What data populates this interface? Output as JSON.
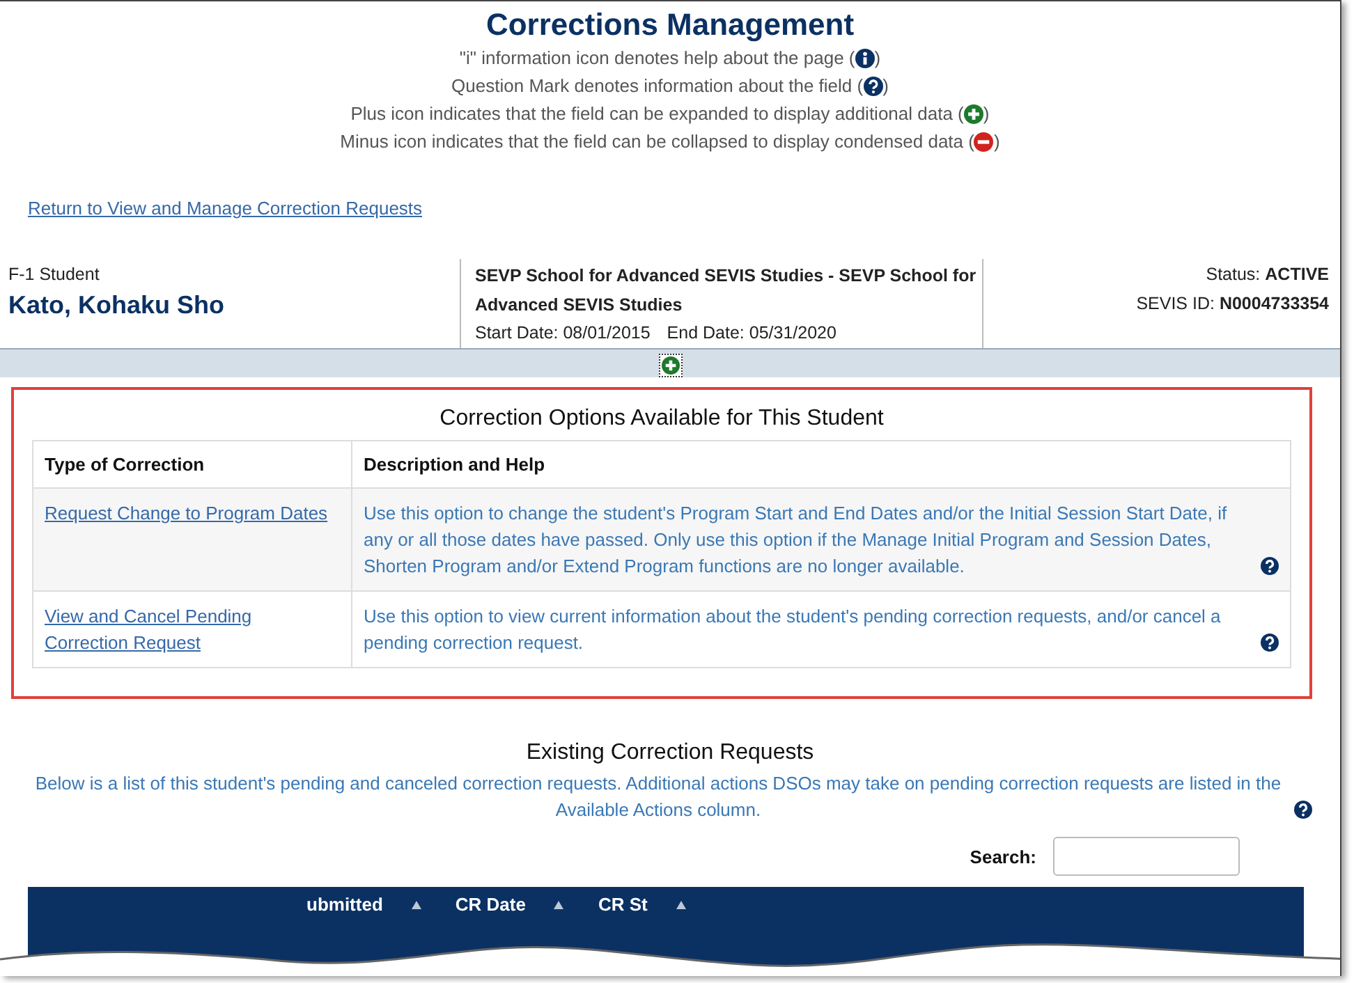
{
  "title": "Corrections Management",
  "legend": [
    {
      "text": "\"i\" information icon denotes help about the page (",
      "kind": "info",
      "close": ")"
    },
    {
      "text": "Question Mark denotes information about the field (",
      "kind": "question",
      "close": ")"
    },
    {
      "text": "Plus icon indicates that the field can be expanded to display additional data (",
      "kind": "plus",
      "close": ")"
    },
    {
      "text": "Minus icon indicates that the field can be collapsed to display condensed data (",
      "kind": "minus",
      "close": ")"
    }
  ],
  "return_link": "Return to View and Manage Correction Requests",
  "student": {
    "type": "F-1 Student",
    "name": "Kato, Kohaku Sho"
  },
  "school": {
    "name": "SEVP School for Advanced SEVIS Studies - SEVP School for Advanced SEVIS Studies",
    "start_label": "Start Date:",
    "start": "08/01/2015",
    "end_label": "End Date:",
    "end": "05/31/2020"
  },
  "status": {
    "label": "Status:",
    "value": "ACTIVE"
  },
  "sevis": {
    "label": "SEVIS ID:",
    "value": "N0004733354"
  },
  "details_expanded": false,
  "options": {
    "title": "Correction Options Available for This Student",
    "columns": [
      "Type of Correction",
      "Description and Help"
    ],
    "rows": [
      {
        "link": "Request Change to Program Dates",
        "description": "Use this option to change the student's Program Start and End Dates and/or the Initial Session Start Date, if any or all those dates have passed. Only use this option if the Manage Initial Program and Session Dates, Shorten Program and/or Extend Program functions are no longer available."
      },
      {
        "link": "View and Cancel Pending Correction Request",
        "description": "Use this option to view current information about the student's pending correction requests, and/or cancel a pending correction request."
      }
    ]
  },
  "existing": {
    "title": "Existing Correction Requests",
    "description": "Below is a list of this student's pending and canceled correction requests. Additional actions DSOs may take on pending correction requests are listed in the Available Actions column."
  },
  "search": {
    "label": "Search:"
  },
  "requests_table": {
    "columns": [
      "ubmitted",
      "CR Date",
      "CR St"
    ]
  }
}
